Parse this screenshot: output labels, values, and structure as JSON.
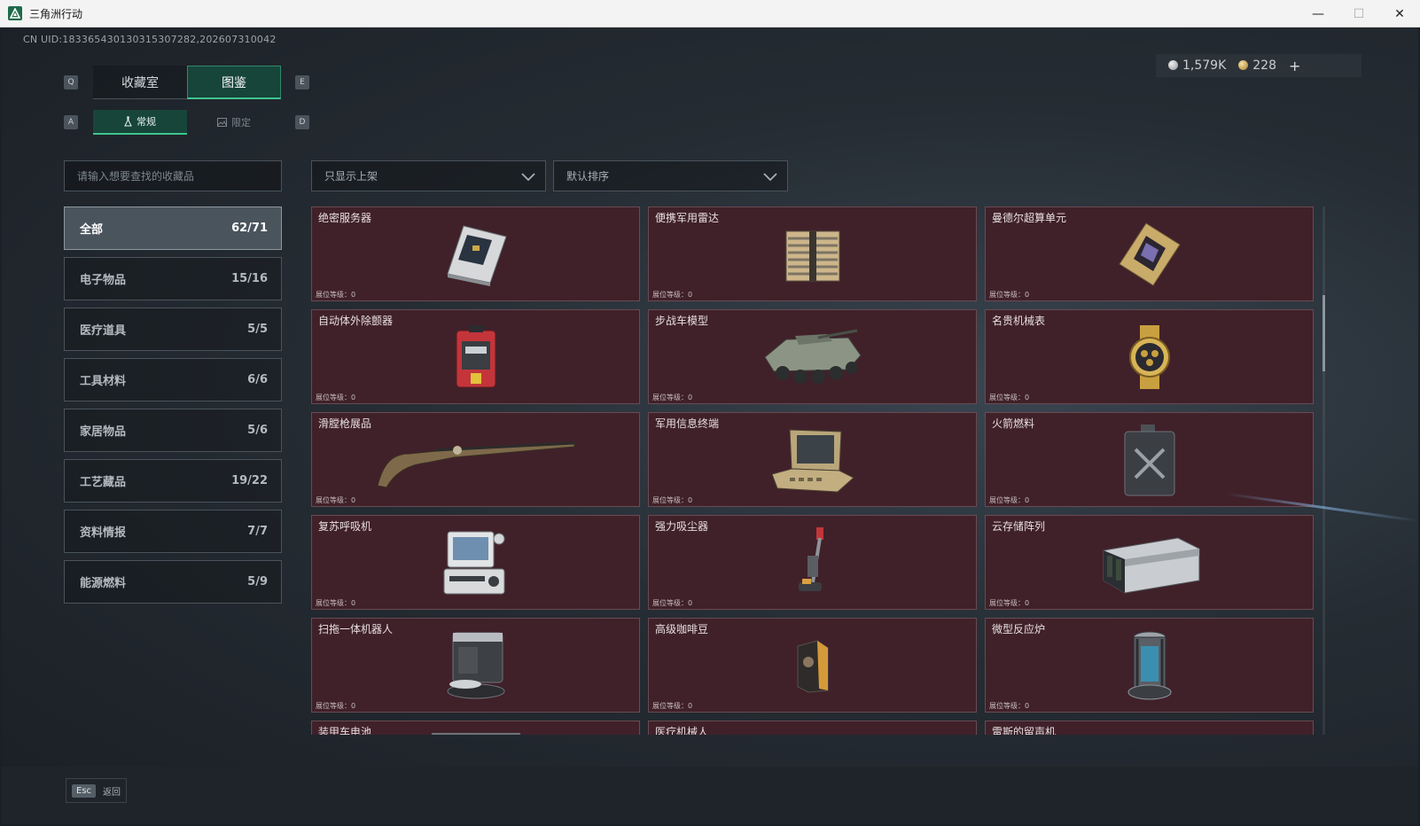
{
  "window": {
    "title": "三角洲行动"
  },
  "header": {
    "uid": "CN UID:18336543013031530728​2,202607310042",
    "currency": {
      "silver": "1,579K",
      "gold": "228",
      "add": "+"
    }
  },
  "tabs": {
    "prev_key": "Q",
    "next_key": "E",
    "items": [
      {
        "label": "收藏室"
      },
      {
        "label": "图鉴"
      }
    ],
    "active": 1
  },
  "subtabs": {
    "prev_key": "A",
    "next_key": "D",
    "items": [
      {
        "label": "常规"
      },
      {
        "label": "限定"
      }
    ],
    "active": 0
  },
  "search": {
    "placeholder": "请输入想要查找的收藏品"
  },
  "filters": {
    "shelf": "只显示上架",
    "sort": "默认排序"
  },
  "categories": [
    {
      "label": "全部",
      "count": "62/71"
    },
    {
      "label": "电子物品",
      "count": "15/16"
    },
    {
      "label": "医疗道具",
      "count": "5/5"
    },
    {
      "label": "工具材料",
      "count": "6/6"
    },
    {
      "label": "家居物品",
      "count": "5/6"
    },
    {
      "label": "工艺藏品",
      "count": "19/22"
    },
    {
      "label": "资料情报",
      "count": "7/7"
    },
    {
      "label": "能源燃料",
      "count": "5/9"
    }
  ],
  "items": [
    {
      "name": "绝密服务器",
      "level": "展位等级：0",
      "icon": "server-icon"
    },
    {
      "name": "便携军用雷达",
      "level": "展位等级：0",
      "icon": "radar-icon"
    },
    {
      "name": "曼德尔超算单元",
      "level": "展位等级：0",
      "icon": "chip-icon"
    },
    {
      "name": "自动体外除颤器",
      "level": "展位等级：0",
      "icon": "defibrillator-icon"
    },
    {
      "name": "步战车模型",
      "level": "展位等级：0",
      "icon": "vehicle-icon"
    },
    {
      "name": "名贵机械表",
      "level": "展位等级：0",
      "icon": "watch-icon"
    },
    {
      "name": "滑膛枪展品",
      "level": "展位等级：0",
      "icon": "musket-icon"
    },
    {
      "name": "军用信息终端",
      "level": "展位等级：0",
      "icon": "terminal-icon"
    },
    {
      "name": "火箭燃料",
      "level": "展位等级：0",
      "icon": "fuel-can-icon"
    },
    {
      "name": "复苏呼吸机",
      "level": "展位等级：0",
      "icon": "ventilator-icon"
    },
    {
      "name": "强力吸尘器",
      "level": "展位等级：0",
      "icon": "vacuum-icon"
    },
    {
      "name": "云存储阵列",
      "level": "展位等级：0",
      "icon": "storage-array-icon"
    },
    {
      "name": "扫拖一体机器人",
      "level": "展位等级：0",
      "icon": "robot-icon"
    },
    {
      "name": "高级咖啡豆",
      "level": "展位等级：0",
      "icon": "coffee-bag-icon"
    },
    {
      "name": "微型反应炉",
      "level": "展位等级：0",
      "icon": "reactor-icon"
    },
    {
      "name": "装甲车电池",
      "level": "",
      "icon": "battery-icon"
    },
    {
      "name": "医疗机械人",
      "level": "",
      "icon": "medical-robot-icon"
    },
    {
      "name": "雷斯的留声机",
      "level": "",
      "icon": "gramophone-icon"
    }
  ],
  "footer": {
    "esc_key": "Esc",
    "back_label": "返回"
  },
  "colors": {
    "accent": "#3fc48f",
    "card_bg": "#40212a",
    "card_border": "#6a4a52"
  }
}
